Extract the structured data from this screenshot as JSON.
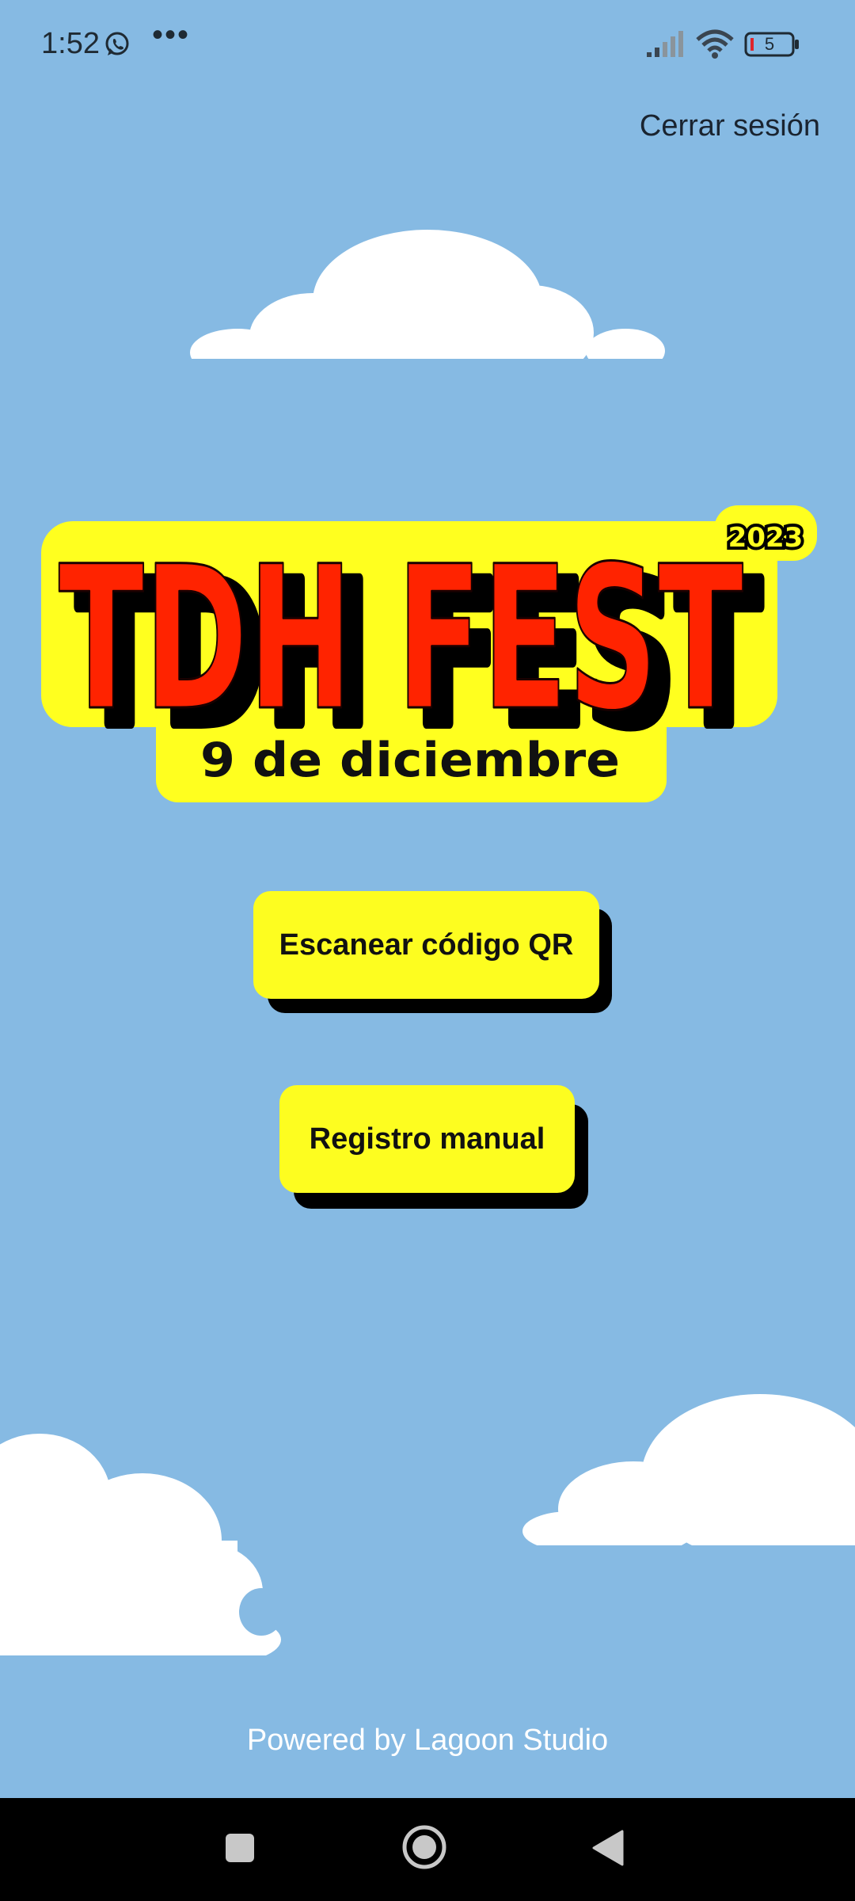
{
  "status_bar": {
    "time": "1:52",
    "more_dots": "•••",
    "battery_level": "5",
    "icons": [
      "whatsapp-icon",
      "signal-icon",
      "wifi-icon",
      "battery-icon"
    ]
  },
  "header": {
    "logout_label": "Cerrar sesión"
  },
  "logo": {
    "title": "TDH FEST",
    "year": "2023",
    "date": "9 de diciembre"
  },
  "actions": {
    "scan_label": "Escanear código QR",
    "manual_label": "Registro manual"
  },
  "footer": {
    "powered_by": "Powered by Lagoon Studio"
  },
  "nav_bar": {
    "icons": [
      "recents-icon",
      "home-icon",
      "back-icon"
    ]
  },
  "colors": {
    "background": "#86BAE3",
    "button": "#FDFD20",
    "logo_red": "#FF2300",
    "logo_yellow": "#FFFF1F"
  }
}
